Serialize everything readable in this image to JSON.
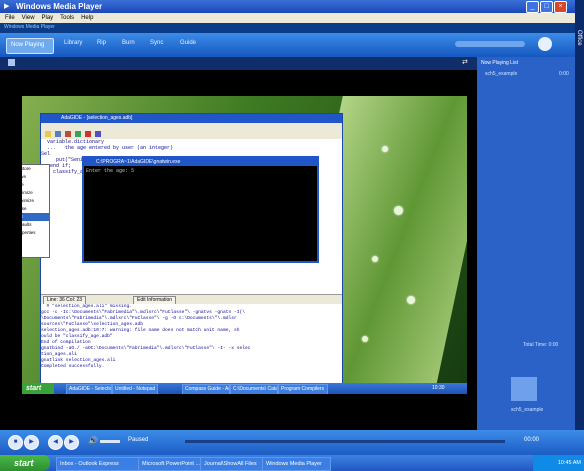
{
  "app": {
    "title": "Windows Media Player"
  },
  "menu": [
    "File",
    "View",
    "Play",
    "Tools",
    "Help"
  ],
  "secondary_bar": {
    "text": "Windows Media Player"
  },
  "nav_tabs": [
    "Now Playing",
    "Library",
    "Rip",
    "Burn",
    "Sync",
    "Guide"
  ],
  "playlist": {
    "name": "Now Playing List",
    "current": "sch5_example",
    "duration": "0:00",
    "total": "Total Time: 0:00",
    "bottom_label": "sch5_example"
  },
  "right_strip_label": "Office",
  "inner": {
    "ada_title": "AdaGIDE - [selection_ages.adb]",
    "console_title": "C:\\PROGRA~1\\AdaGIDE\\gnatwin.exe",
    "console_text": "Enter the age: 5",
    "code_lines": [
      "  variable.dictionary",
      "  ...   the age entered by user (an integer)",
      "",
      "Sel",
      "",
      "",
      "",
      "",
      "",
      "",
      "",
      "",
      "",
      "",
      "",
      "",
      "",
      "",
      "",
      "",
      "     put(\"Seniorid age\");",
      "   end if;",
      "end classify_age;"
    ],
    "tabs": [
      "Line: 36 Col: 23",
      "Edit Information"
    ],
    "output_lines": [
      "  # \"selection_ages.ali\" missing.",
      "gcc -c -Ic:\\Documents\\\"Fabrimedia\"\\.mdlsrc\\\"FuClasse\"\\ -gnatvs -gnatn -I(\\",
      "\\Documents\\\"Fabrimedia\"\\.mdlsrc\\\"FuClasse\"\\ -g -O c:\\Documents\\\"\\.mdlsr",
      "sources\\\"FuClasse\"\\selection_ages.adb",
      "selection_ages.adb:10:7: warning: file name does not match unit name, sh",
      "ould be \"classify_age.adb\"",
      "End of compilation",
      "gnatbind -aO./ -aOC:\\Documents\\\"Fabrimedia\"\\.mdlsrc\\\"FuClasse\"\\ -I- -x selec",
      "tion_ages.ali",
      "gnatlink selection_ages.ali",
      "Completed successfully."
    ],
    "context_menu": [
      "Restore",
      "Move",
      "Size",
      "Minimize",
      "Maximize",
      "Close",
      "Edit",
      "Defaults",
      "Properties"
    ],
    "taskbar": {
      "start": "start",
      "items": [
        "AdaGIDE - Selection...",
        "Untitled - Notepad",
        "Compass Guide - Ad...",
        "C:\\Documents\\ Catalog",
        "Program Compilers"
      ],
      "clock": "10:30"
    }
  },
  "status": {
    "state": "Paused",
    "time": "00:00"
  },
  "taskbar": {
    "start": "start",
    "items": [
      "Inbox - Outlook Express",
      "Microsoft PowerPoint ...",
      "Journal\\ShowAll Files",
      "Windows Media Player"
    ],
    "clock": "10:45 AM"
  },
  "colors": {
    "accent": "#1c48b8",
    "start_green": "#2d8f2d"
  }
}
